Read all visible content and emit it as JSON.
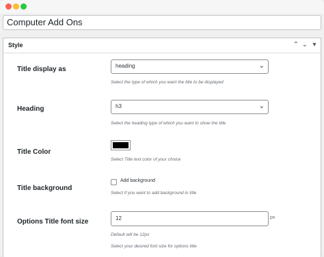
{
  "window": {
    "controls": [
      "close",
      "minimize",
      "maximize"
    ]
  },
  "post_title": {
    "value": "Computer Add Ons"
  },
  "panel": {
    "title": "Style",
    "icons": [
      "chevron-up-icon",
      "chevron-down-icon",
      "triangle-down-icon"
    ]
  },
  "fields": {
    "title_display": {
      "label": "Title display as",
      "selected": "heading",
      "help": "Select the type of which you want the title to be displayed"
    },
    "heading": {
      "label": "Heading",
      "selected": "h3",
      "help": "Select the heading type of which you want to show the title"
    },
    "title_color": {
      "label": "Title Color",
      "color": "#000000",
      "help": "Select Title text color of your choice"
    },
    "title_background": {
      "label": "Title background",
      "checkbox_label": "Add background",
      "checked": false,
      "help": "Select if you want to add background in title"
    },
    "options_font_size": {
      "label": "Options Title font size",
      "value": "12",
      "unit": "px",
      "default_note": "Default will be 12px",
      "help": "Select your desired font size for options title"
    }
  }
}
